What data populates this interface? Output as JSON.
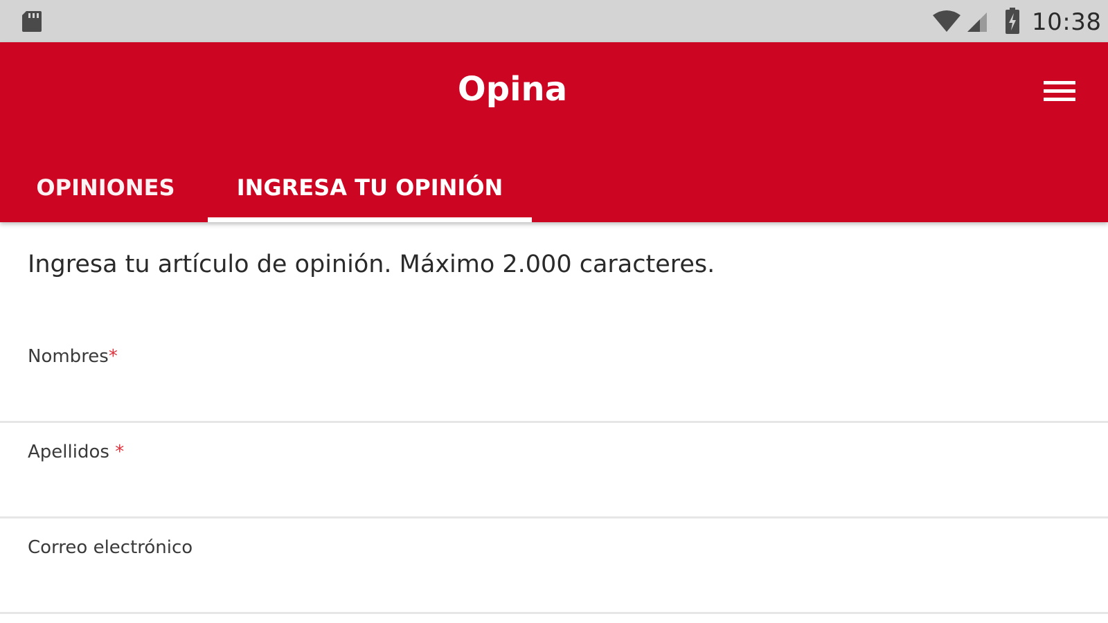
{
  "status_bar": {
    "time": "10:38",
    "icons": [
      "sd-card-icon",
      "wifi-icon",
      "cell-signal-icon",
      "battery-charging-icon"
    ]
  },
  "app_bar": {
    "title": "Opina",
    "menu_icon": "hamburger-menu-icon",
    "color": "#cc0523"
  },
  "tabs": [
    {
      "label": "OPINIONES",
      "selected": false
    },
    {
      "label": "INGRESA TU OPINIÓN",
      "selected": true
    }
  ],
  "form": {
    "intro": "Ingresa tu artículo de opinión. Máximo 2.000 caracteres.",
    "fields": [
      {
        "label": "Nombres",
        "required_mark": "*",
        "value": ""
      },
      {
        "label": "Apellidos ",
        "required_mark": "*",
        "value": ""
      },
      {
        "label": "Correo electrónico",
        "required_mark": "",
        "value": ""
      }
    ]
  }
}
